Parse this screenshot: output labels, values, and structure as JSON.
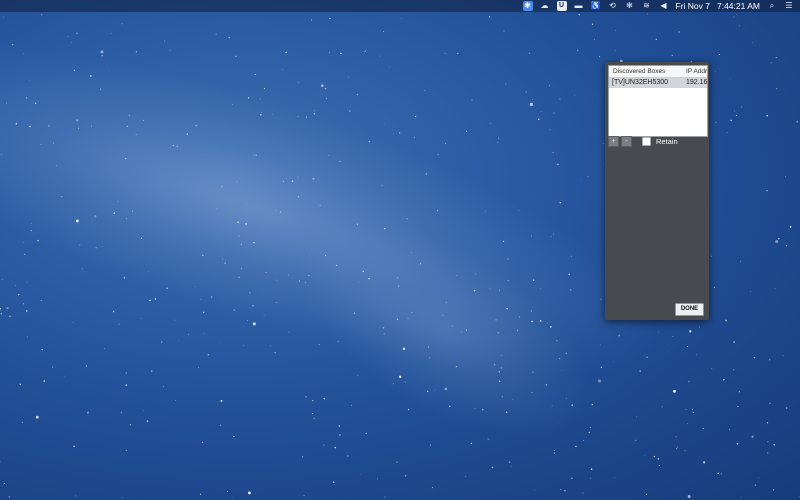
{
  "menubar": {
    "icons": [
      {
        "name": "app-status-icon",
        "glyph": "✱",
        "active": true
      },
      {
        "name": "cloud-sync-icon",
        "glyph": "☁",
        "active": false
      },
      {
        "name": "shield-u-icon",
        "glyph": "U",
        "active": false
      },
      {
        "name": "display-icon",
        "glyph": "▬",
        "active": false
      },
      {
        "name": "accessibility-icon",
        "glyph": "♿",
        "active": false
      },
      {
        "name": "time-machine-icon",
        "glyph": "⟲",
        "active": false
      },
      {
        "name": "bluetooth-icon",
        "glyph": "✻",
        "active": false
      },
      {
        "name": "wifi-icon",
        "glyph": "≋",
        "active": false
      },
      {
        "name": "volume-icon",
        "glyph": "◀",
        "active": false
      }
    ],
    "date": "Fri Nov 7",
    "time": "7:44:21 AM",
    "search_icon_glyph": "⌕",
    "list_icon_glyph": "☰"
  },
  "panel": {
    "table": {
      "columns": [
        "Discovered Boxes",
        "IP Addr"
      ],
      "rows": [
        {
          "name": "[TV]UN32EH5300",
          "ip": "192.16"
        }
      ]
    },
    "add_label": "+",
    "remove_label": "-",
    "retain_label": "Retain",
    "retain_checked": false,
    "done_label": "DONE"
  }
}
